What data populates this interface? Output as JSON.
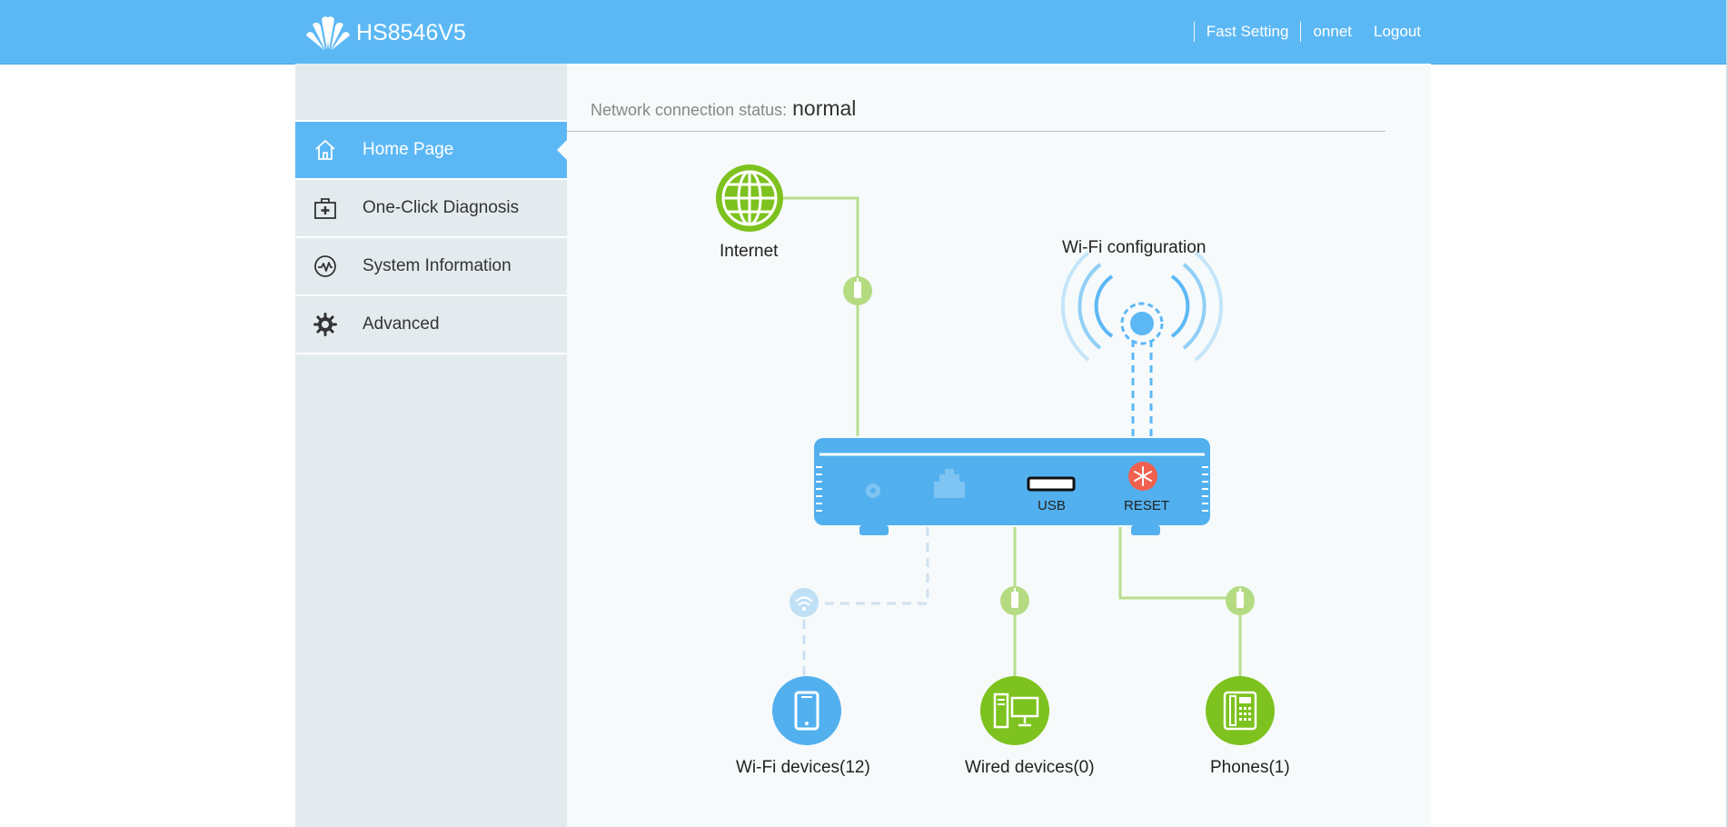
{
  "header": {
    "model": "HS8546V5",
    "nav": {
      "fast_setting": "Fast Setting",
      "user": "onnet",
      "logout": "Logout"
    }
  },
  "sidebar": {
    "items": [
      {
        "label": "Home Page",
        "icon": "home-icon",
        "active": true
      },
      {
        "label": "One-Click Diagnosis",
        "icon": "diagnosis-kit-icon",
        "active": false
      },
      {
        "label": "System Information",
        "icon": "pulse-icon",
        "active": false
      },
      {
        "label": "Advanced",
        "icon": "gear-icon",
        "active": false
      }
    ]
  },
  "status": {
    "label": "Network connection status:",
    "value": "normal"
  },
  "topology": {
    "internet_label": "Internet",
    "wifi_config_label": "Wi-Fi configuration",
    "usb_label": "USB",
    "reset_label": "RESET",
    "wifi_devices_label": "Wi-Fi devices(12)",
    "wired_devices_label": "Wired devices(0)",
    "phones_label": "Phones(1)"
  },
  "colors": {
    "header_blue": "#5cb8f5",
    "router_blue": "#52b0ef",
    "green": "#7dc21e",
    "light_green": "#c4e29a",
    "reset_red": "#f0604f",
    "sidebar_bg": "#e4ebee",
    "content_bg": "#f6fafb"
  }
}
